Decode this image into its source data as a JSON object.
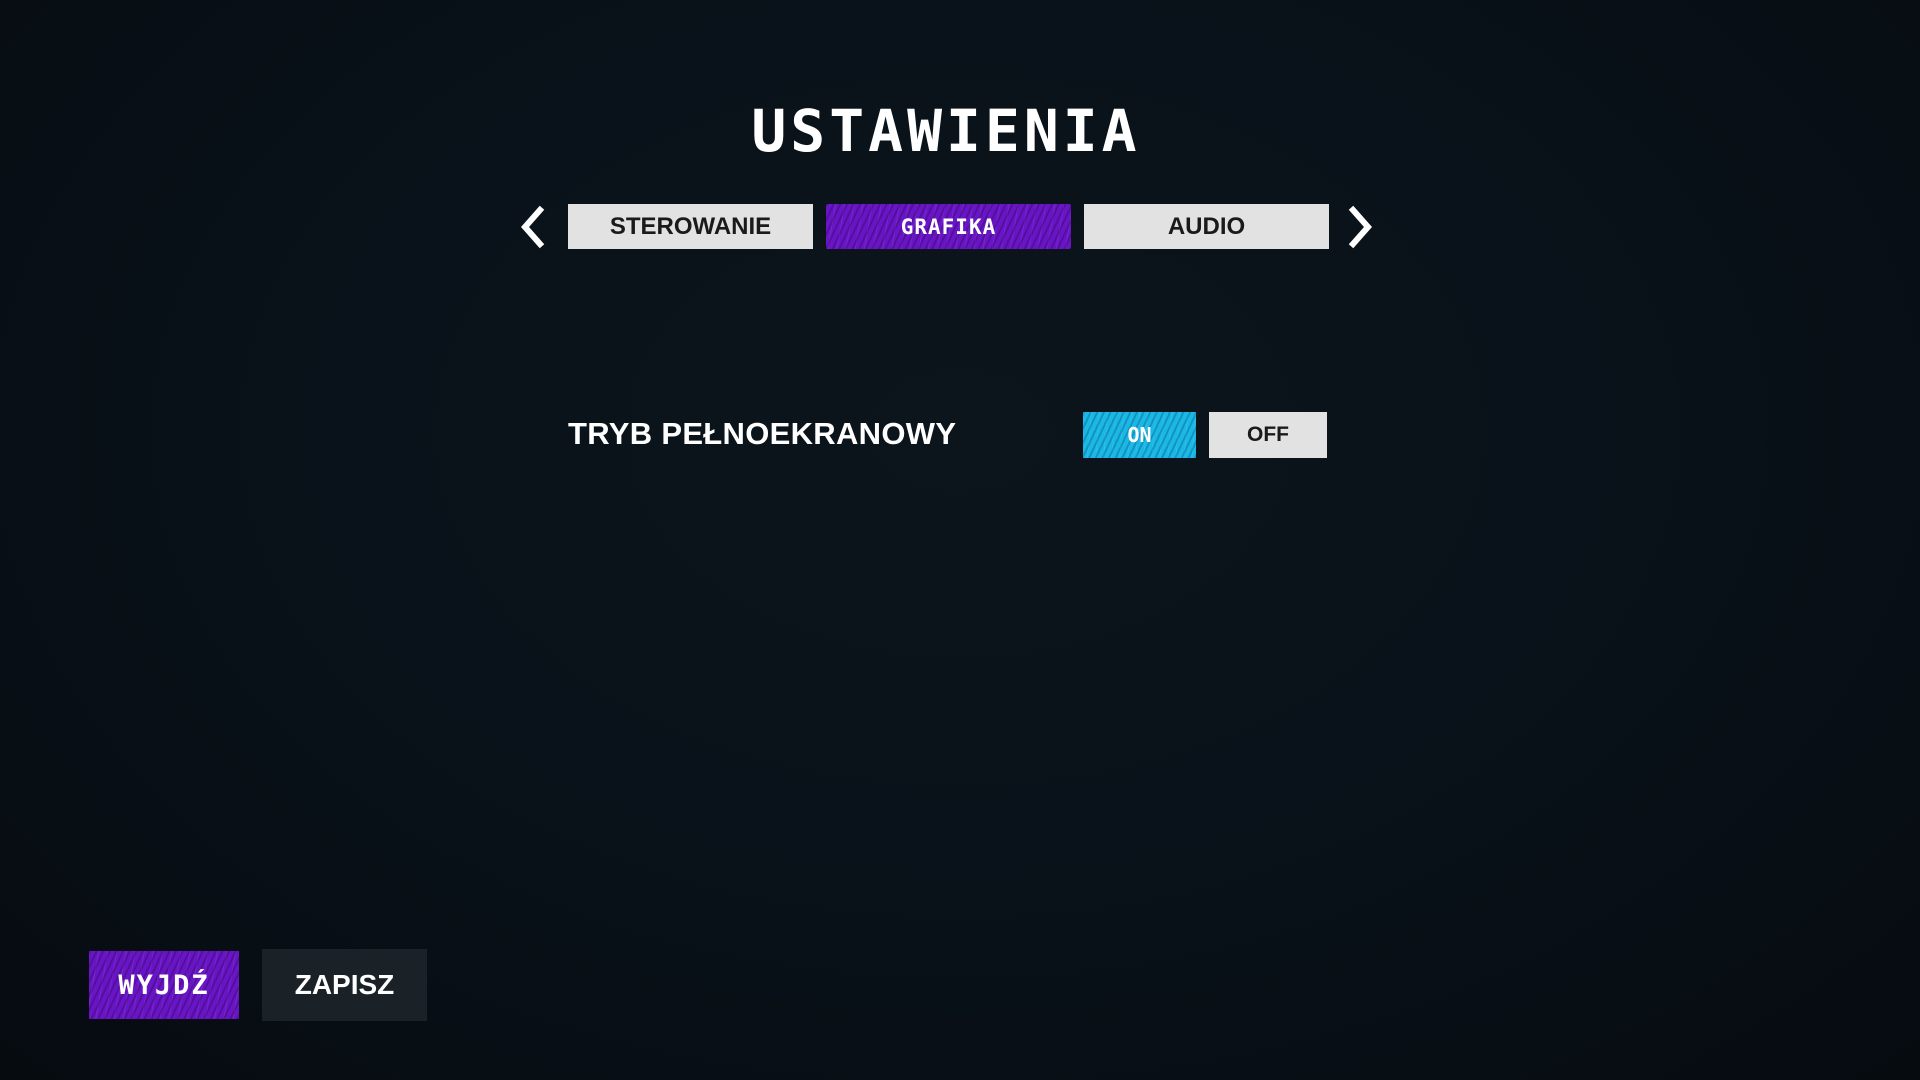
{
  "header": {
    "title": "USTAWIENIA"
  },
  "tabs": {
    "prev_icon": "chevron-left-icon",
    "next_icon": "chevron-right-icon",
    "items": [
      {
        "label": "STEROWANIE",
        "active": false
      },
      {
        "label": "GRAFIKA",
        "active": true
      },
      {
        "label": "AUDIO",
        "active": false
      }
    ]
  },
  "settings": {
    "fullscreen": {
      "label": "TRYB PEŁNOEKRANOWY",
      "on_label": "ON",
      "off_label": "OFF",
      "selected": "ON"
    }
  },
  "footer": {
    "exit_label": "WYJDŹ",
    "save_label": "ZAPISZ"
  },
  "colors": {
    "background": "#09121a",
    "accent_purple": "#6a14c8",
    "accent_cyan": "#19b8e6",
    "inactive_button": "#e2e2e2",
    "save_button": "#1a2127"
  }
}
